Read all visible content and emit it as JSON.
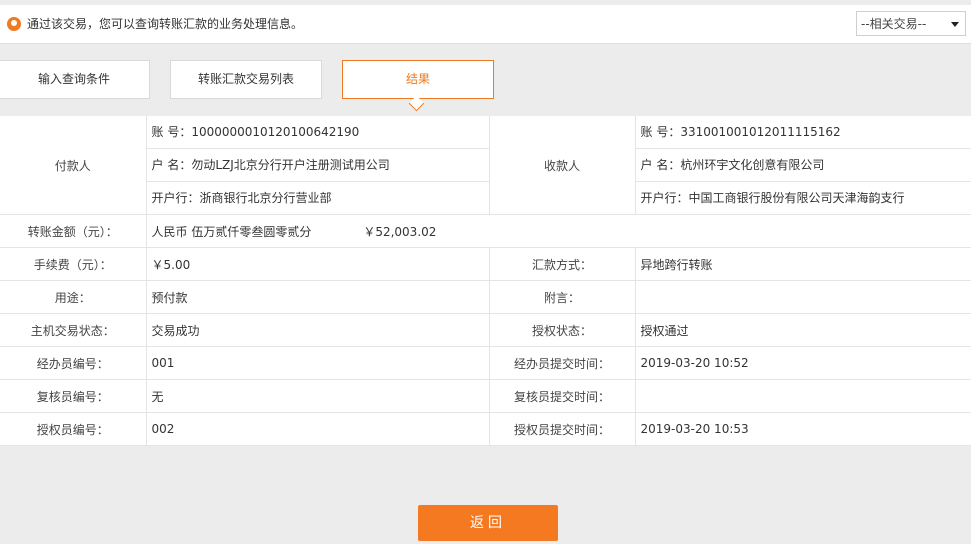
{
  "notice": {
    "text": "通过该交易，您可以查询转账汇款的业务处理信息。",
    "related_select": "--相关交易--"
  },
  "steps": [
    {
      "label": "输入查询条件"
    },
    {
      "label": "转账汇款交易列表"
    },
    {
      "label": "结果"
    }
  ],
  "colors": {
    "accent": "#ef7a22",
    "button": "#f47920"
  },
  "payer": {
    "label": "付款人",
    "account": "账 号：1000000010120100642190",
    "name": "户 名：勿动LZJ北京分行开户注册测试用公司",
    "bank": "开户行：浙商银行北京分行营业部"
  },
  "payee": {
    "label": "收款人",
    "account": "账 号：331001001012011115162",
    "name": "户 名：杭州环宇文化创意有限公司",
    "bank": "开户行：中国工商银行股份有限公司天津海韵支行"
  },
  "amount": {
    "label": "转账金额（元）：",
    "words": "人民币 伍万贰仟零叁圆零贰分",
    "number": "￥52,003.02"
  },
  "rows": [
    {
      "l1": "手续费（元）：",
      "v1": "￥5.00",
      "l2": "汇款方式：",
      "v2": "异地跨行转账"
    },
    {
      "l1": "用途：",
      "v1": "预付款",
      "l2": "附言：",
      "v2": ""
    },
    {
      "l1": "主机交易状态：",
      "v1": "交易成功",
      "l2": "授权状态：",
      "v2": "授权通过"
    },
    {
      "l1": "经办员编号：",
      "v1": "001",
      "l2": "经办员提交时间：",
      "v2": "2019-03-20 10:52"
    },
    {
      "l1": "复核员编号：",
      "v1": "无",
      "l2": "复核员提交时间：",
      "v2": ""
    },
    {
      "l1": "授权员编号：",
      "v1": "002",
      "l2": "授权员提交时间：",
      "v2": "2019-03-20 10:53"
    }
  ],
  "back_button": "返回"
}
